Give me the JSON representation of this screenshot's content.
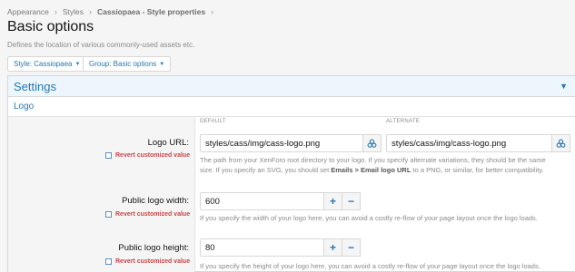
{
  "breadcrumb": {
    "items": [
      "Appearance",
      "Styles",
      "Cassiopaea - Style properties"
    ],
    "separator": "›"
  },
  "page": {
    "title": "Basic options",
    "description": "Defines the location of various commonly-used assets etc."
  },
  "filters": {
    "style_label": "Style: Cassiopaea",
    "group_label": "Group: Basic options"
  },
  "panel": {
    "title": "Settings",
    "section": "Logo",
    "column_default": "DEFAULT",
    "column_alternate": "ALTERNATE"
  },
  "fields": {
    "logo_url": {
      "label": "Logo URL:",
      "default_value": "styles/cass/img/cass-logo.png",
      "alternate_value": "styles/cass/img/cass-logo.png",
      "revert_label": "Revert customized value",
      "hint_1": "The path from your XenForo root directory to your logo. If you specify alternate variations, they should be the same",
      "hint_2a": "size. If you specify an SVG, you should set ",
      "hint_2b": "Emails > Email logo URL",
      "hint_2c": " to a PNG, or similar, for better compatibility."
    },
    "logo_width": {
      "label": "Public logo width:",
      "value": "600",
      "revert_label": "Revert customized value",
      "hint": "If you specify the width of your logo here, you can avoid a costly re-flow of your page layout once the logo loads."
    },
    "logo_height": {
      "label": "Public logo height:",
      "value": "80",
      "revert_label": "Revert customized value",
      "hint": "If you specify the height of your logo here, you can avoid a costly re-flow of your page layout once the logo loads."
    }
  },
  "icons": {
    "image_picker": "palette-icon",
    "dropdown": "caret-down-icon",
    "collapse": "caret-down-icon"
  },
  "colors": {
    "accent": "#2577b1",
    "revert": "#c84448",
    "header_bg": "#edf6fd"
  }
}
